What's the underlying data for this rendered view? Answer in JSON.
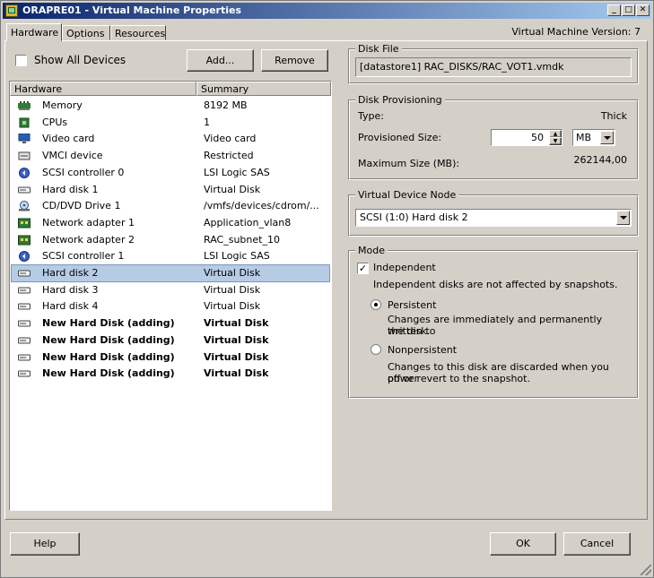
{
  "window": {
    "title": "ORAPRE01 - Virtual Machine Properties",
    "vm_version": "Virtual Machine Version: 7",
    "controls": [
      "_",
      "□",
      "✕"
    ]
  },
  "tabs": [
    {
      "label": "Hardware",
      "active": true
    },
    {
      "label": "Options",
      "active": false
    },
    {
      "label": "Resources",
      "active": false
    }
  ],
  "toolbar": {
    "show_all_devices_label": "Show All Devices",
    "show_all_devices_checked": false,
    "add_label": "Add...",
    "remove_label": "Remove"
  },
  "hardware_list": {
    "columns": [
      "Hardware",
      "Summary"
    ],
    "rows": [
      {
        "icon": "memory-icon",
        "name": "Memory",
        "summary": "8192 MB"
      },
      {
        "icon": "cpu-icon",
        "name": "CPUs",
        "summary": "1"
      },
      {
        "icon": "video-card-icon",
        "name": "Video card",
        "summary": "Video card"
      },
      {
        "icon": "vmci-icon",
        "name": "VMCI device",
        "summary": "Restricted"
      },
      {
        "icon": "scsi-controller-icon",
        "name": "SCSI controller 0",
        "summary": "LSI Logic SAS"
      },
      {
        "icon": "hard-disk-icon",
        "name": "Hard disk 1",
        "summary": "Virtual Disk"
      },
      {
        "icon": "cdrom-icon",
        "name": "CD/DVD Drive 1",
        "summary": "/vmfs/devices/cdrom/..."
      },
      {
        "icon": "network-adapter-icon",
        "name": "Network adapter 1",
        "summary": "Application_vlan8"
      },
      {
        "icon": "network-adapter-icon",
        "name": "Network adapter 2",
        "summary": "RAC_subnet_10"
      },
      {
        "icon": "scsi-controller-icon",
        "name": "SCSI controller 1",
        "summary": "LSI Logic SAS"
      },
      {
        "icon": "hard-disk-icon",
        "name": "Hard disk 2",
        "summary": "Virtual Disk",
        "selected": true
      },
      {
        "icon": "hard-disk-icon",
        "name": "Hard disk 3",
        "summary": "Virtual Disk"
      },
      {
        "icon": "hard-disk-icon",
        "name": "Hard disk 4",
        "summary": "Virtual Disk"
      },
      {
        "icon": "hard-disk-icon",
        "name": "New Hard Disk (adding)",
        "summary": "Virtual Disk",
        "bold": true
      },
      {
        "icon": "hard-disk-icon",
        "name": "New Hard Disk (adding)",
        "summary": "Virtual Disk",
        "bold": true
      },
      {
        "icon": "hard-disk-icon",
        "name": "New Hard Disk (adding)",
        "summary": "Virtual Disk",
        "bold": true
      },
      {
        "icon": "hard-disk-icon",
        "name": "New Hard Disk (adding)",
        "summary": "Virtual Disk",
        "bold": true
      }
    ]
  },
  "disk_file": {
    "legend": "Disk File",
    "path": "[datastore1] RAC_DISKS/RAC_VOT1.vmdk"
  },
  "disk_provisioning": {
    "legend": "Disk Provisioning",
    "type_label": "Type:",
    "type_value": "Thick",
    "provisioned_size_label": "Provisioned Size:",
    "provisioned_size_value": "50",
    "unit_value": "MB",
    "max_size_label": "Maximum Size (MB):",
    "max_size_value": "262144,00"
  },
  "virtual_device_node": {
    "legend": "Virtual Device Node",
    "selected": "SCSI (1:0) Hard disk 2"
  },
  "mode": {
    "legend": "Mode",
    "independent_label": "Independent",
    "independent_checked": true,
    "independent_desc": "Independent disks are not affected by snapshots.",
    "persistent_label": "Persistent",
    "persistent_selected": true,
    "persistent_desc_1": "Changes are immediately and permanently written to",
    "persistent_desc_2": "the disk.",
    "nonpersistent_label": "Nonpersistent",
    "nonpersistent_desc_1": "Changes to this disk are discarded when you power",
    "nonpersistent_desc_2": "off or revert to the snapshot."
  },
  "footer": {
    "help_label": "Help",
    "ok_label": "OK",
    "cancel_label": "Cancel"
  }
}
